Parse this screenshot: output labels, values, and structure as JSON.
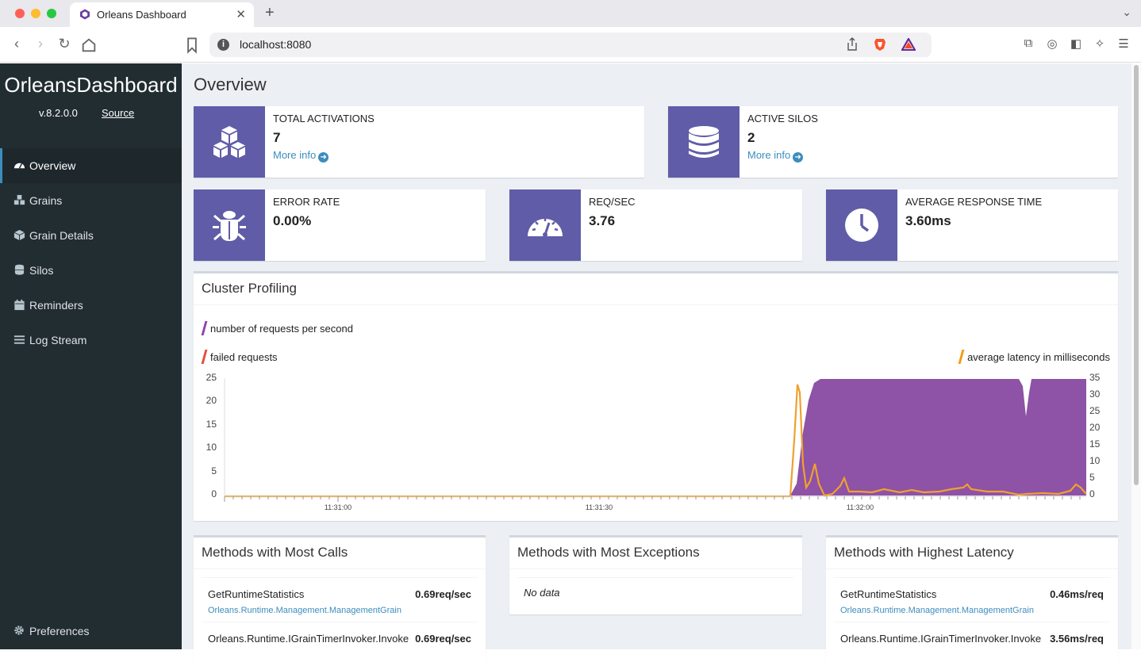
{
  "browser": {
    "tab_title": "Orleans Dashboard",
    "url": "localhost:8080"
  },
  "sidebar": {
    "brand": "OrleansDashboard",
    "version": "v.8.2.0.0",
    "source_label": "Source",
    "items": [
      {
        "label": "Overview",
        "icon": "dashboard-icon",
        "active": true
      },
      {
        "label": "Grains",
        "icon": "cubes-icon"
      },
      {
        "label": "Grain Details",
        "icon": "cube-icon"
      },
      {
        "label": "Silos",
        "icon": "database-icon"
      },
      {
        "label": "Reminders",
        "icon": "calendar-icon"
      },
      {
        "label": "Log Stream",
        "icon": "bars-icon"
      }
    ],
    "preferences_label": "Preferences"
  },
  "overview": {
    "title": "Overview",
    "total_activations": {
      "label": "TOTAL ACTIVATIONS",
      "value": "7",
      "more": "More info"
    },
    "active_silos": {
      "label": "ACTIVE SILOS",
      "value": "2",
      "more": "More info"
    },
    "error_rate": {
      "label": "ERROR RATE",
      "value": "0.00%"
    },
    "req_sec": {
      "label": "REQ/SEC",
      "value": "3.76"
    },
    "avg_response": {
      "label": "AVERAGE RESPONSE TIME",
      "value": "3.60ms"
    }
  },
  "cluster": {
    "title": "Cluster Profiling",
    "legend": {
      "requests": "number of requests per second",
      "failed": "failed requests",
      "latency": "average latency in milliseconds"
    }
  },
  "colors": {
    "accent": "#605ca8",
    "requests": "#8e44ad",
    "failed": "#e74c3c",
    "latency": "#f39c12",
    "link": "#3c8dbc",
    "sidebar": "#222d32"
  },
  "chart_data": {
    "type": "area",
    "x": [
      "11:31:00",
      "11:31:30",
      "11:32:00"
    ],
    "left_axis": {
      "ticks": [
        "0",
        "5",
        "10",
        "15",
        "20",
        "25"
      ],
      "ylim": [
        0,
        25
      ]
    },
    "right_axis": {
      "ticks": [
        "0",
        "5",
        "10",
        "15",
        "20",
        "25",
        "30",
        "35"
      ],
      "ylim": [
        0,
        35
      ]
    },
    "series": [
      {
        "name": "number of requests per second",
        "axis": "left",
        "values_summary": "0 until ~11:31:52, then rising to ~25 and staying near 25 with a dip to ~17"
      },
      {
        "name": "failed requests",
        "axis": "left",
        "values": [
          0
        ]
      },
      {
        "name": "average latency in milliseconds",
        "axis": "right",
        "values_summary": "0 then spike to ~33 near 11:31:52, decaying to ~1-3"
      }
    ]
  },
  "stats": {
    "most_calls": {
      "title": "Methods with Most Calls",
      "rows": [
        {
          "method": "GetRuntimeStatistics",
          "grain": "Orleans.Runtime.Management.ManagementGrain",
          "value": "0.69req/sec"
        },
        {
          "method": "Orleans.Runtime.IGrainTimerInvoker.Invoke",
          "value": "0.69req/sec"
        }
      ]
    },
    "most_exceptions": {
      "title": "Methods with Most Exceptions",
      "nodata": "No data"
    },
    "highest_latency": {
      "title": "Methods with Highest Latency",
      "rows": [
        {
          "method": "GetRuntimeStatistics",
          "grain": "Orleans.Runtime.Management.ManagementGrain",
          "value": "0.46ms/req"
        },
        {
          "method": "Orleans.Runtime.IGrainTimerInvoker.Invoke",
          "value": "3.56ms/req"
        }
      ]
    }
  }
}
